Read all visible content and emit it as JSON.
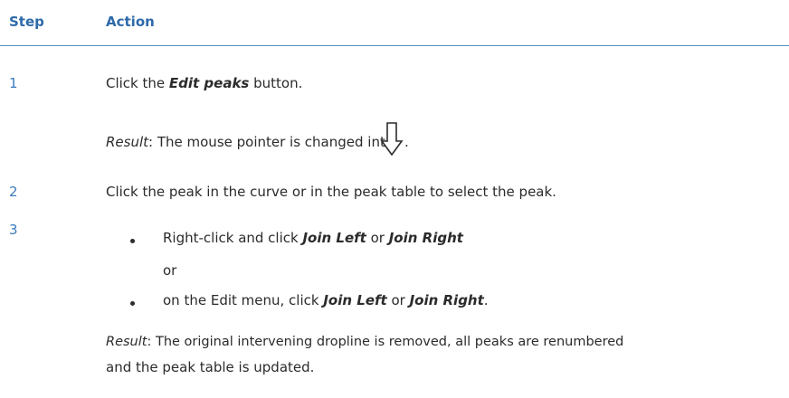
{
  "table": {
    "header": {
      "step": "Step",
      "action": "Action"
    },
    "rows": [
      {
        "step": "1",
        "action": {
          "pre": "Click the ",
          "emph": "Edit peaks",
          "post": " button."
        },
        "result": {
          "label": "Result",
          "text": ": The mouse pointer is changed into ",
          "end": ".",
          "icon": "down-arrow-pointer-icon"
        }
      },
      {
        "step": "2",
        "action": "Click the peak in the curve or in the peak table to select the peak."
      },
      {
        "step": "3",
        "bullets": [
          {
            "pre": "Right-click and click ",
            "a": "Join Left",
            "mid": " or ",
            "b": "Join Right",
            "post": ""
          },
          {
            "pre": "on the Edit menu, click ",
            "a": "Join Left",
            "mid": " or ",
            "b": "Join Right",
            "post": "."
          }
        ],
        "or_text": "or",
        "result": {
          "label": "Result",
          "line1": ": The original intervening dropline is removed, all peaks are renumbered",
          "line2": "and the peak table is updated."
        }
      }
    ]
  }
}
